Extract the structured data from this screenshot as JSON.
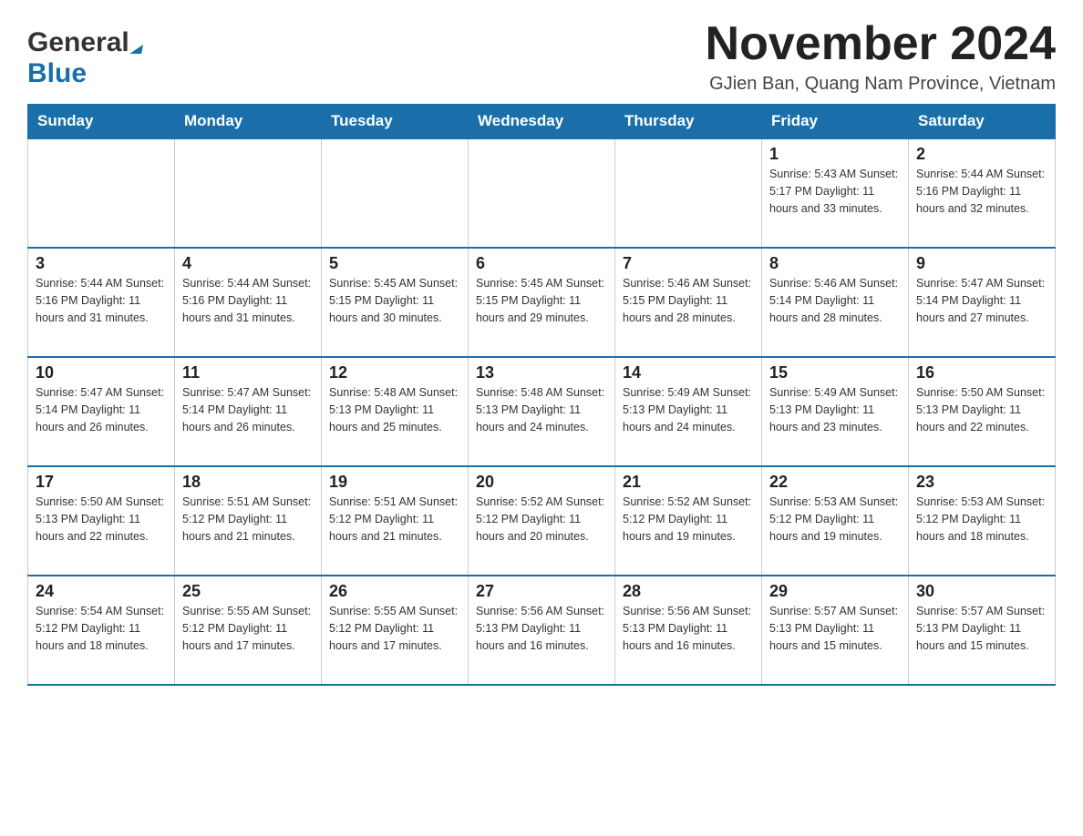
{
  "header": {
    "logo_general": "General",
    "logo_blue": "Blue",
    "month_title": "November 2024",
    "location": "GJien Ban, Quang Nam Province, Vietnam"
  },
  "weekdays": [
    "Sunday",
    "Monday",
    "Tuesday",
    "Wednesday",
    "Thursday",
    "Friday",
    "Saturday"
  ],
  "weeks": [
    [
      {
        "day": "",
        "info": ""
      },
      {
        "day": "",
        "info": ""
      },
      {
        "day": "",
        "info": ""
      },
      {
        "day": "",
        "info": ""
      },
      {
        "day": "",
        "info": ""
      },
      {
        "day": "1",
        "info": "Sunrise: 5:43 AM\nSunset: 5:17 PM\nDaylight: 11 hours and 33 minutes."
      },
      {
        "day": "2",
        "info": "Sunrise: 5:44 AM\nSunset: 5:16 PM\nDaylight: 11 hours and 32 minutes."
      }
    ],
    [
      {
        "day": "3",
        "info": "Sunrise: 5:44 AM\nSunset: 5:16 PM\nDaylight: 11 hours and 31 minutes."
      },
      {
        "day": "4",
        "info": "Sunrise: 5:44 AM\nSunset: 5:16 PM\nDaylight: 11 hours and 31 minutes."
      },
      {
        "day": "5",
        "info": "Sunrise: 5:45 AM\nSunset: 5:15 PM\nDaylight: 11 hours and 30 minutes."
      },
      {
        "day": "6",
        "info": "Sunrise: 5:45 AM\nSunset: 5:15 PM\nDaylight: 11 hours and 29 minutes."
      },
      {
        "day": "7",
        "info": "Sunrise: 5:46 AM\nSunset: 5:15 PM\nDaylight: 11 hours and 28 minutes."
      },
      {
        "day": "8",
        "info": "Sunrise: 5:46 AM\nSunset: 5:14 PM\nDaylight: 11 hours and 28 minutes."
      },
      {
        "day": "9",
        "info": "Sunrise: 5:47 AM\nSunset: 5:14 PM\nDaylight: 11 hours and 27 minutes."
      }
    ],
    [
      {
        "day": "10",
        "info": "Sunrise: 5:47 AM\nSunset: 5:14 PM\nDaylight: 11 hours and 26 minutes."
      },
      {
        "day": "11",
        "info": "Sunrise: 5:47 AM\nSunset: 5:14 PM\nDaylight: 11 hours and 26 minutes."
      },
      {
        "day": "12",
        "info": "Sunrise: 5:48 AM\nSunset: 5:13 PM\nDaylight: 11 hours and 25 minutes."
      },
      {
        "day": "13",
        "info": "Sunrise: 5:48 AM\nSunset: 5:13 PM\nDaylight: 11 hours and 24 minutes."
      },
      {
        "day": "14",
        "info": "Sunrise: 5:49 AM\nSunset: 5:13 PM\nDaylight: 11 hours and 24 minutes."
      },
      {
        "day": "15",
        "info": "Sunrise: 5:49 AM\nSunset: 5:13 PM\nDaylight: 11 hours and 23 minutes."
      },
      {
        "day": "16",
        "info": "Sunrise: 5:50 AM\nSunset: 5:13 PM\nDaylight: 11 hours and 22 minutes."
      }
    ],
    [
      {
        "day": "17",
        "info": "Sunrise: 5:50 AM\nSunset: 5:13 PM\nDaylight: 11 hours and 22 minutes."
      },
      {
        "day": "18",
        "info": "Sunrise: 5:51 AM\nSunset: 5:12 PM\nDaylight: 11 hours and 21 minutes."
      },
      {
        "day": "19",
        "info": "Sunrise: 5:51 AM\nSunset: 5:12 PM\nDaylight: 11 hours and 21 minutes."
      },
      {
        "day": "20",
        "info": "Sunrise: 5:52 AM\nSunset: 5:12 PM\nDaylight: 11 hours and 20 minutes."
      },
      {
        "day": "21",
        "info": "Sunrise: 5:52 AM\nSunset: 5:12 PM\nDaylight: 11 hours and 19 minutes."
      },
      {
        "day": "22",
        "info": "Sunrise: 5:53 AM\nSunset: 5:12 PM\nDaylight: 11 hours and 19 minutes."
      },
      {
        "day": "23",
        "info": "Sunrise: 5:53 AM\nSunset: 5:12 PM\nDaylight: 11 hours and 18 minutes."
      }
    ],
    [
      {
        "day": "24",
        "info": "Sunrise: 5:54 AM\nSunset: 5:12 PM\nDaylight: 11 hours and 18 minutes."
      },
      {
        "day": "25",
        "info": "Sunrise: 5:55 AM\nSunset: 5:12 PM\nDaylight: 11 hours and 17 minutes."
      },
      {
        "day": "26",
        "info": "Sunrise: 5:55 AM\nSunset: 5:12 PM\nDaylight: 11 hours and 17 minutes."
      },
      {
        "day": "27",
        "info": "Sunrise: 5:56 AM\nSunset: 5:13 PM\nDaylight: 11 hours and 16 minutes."
      },
      {
        "day": "28",
        "info": "Sunrise: 5:56 AM\nSunset: 5:13 PM\nDaylight: 11 hours and 16 minutes."
      },
      {
        "day": "29",
        "info": "Sunrise: 5:57 AM\nSunset: 5:13 PM\nDaylight: 11 hours and 15 minutes."
      },
      {
        "day": "30",
        "info": "Sunrise: 5:57 AM\nSunset: 5:13 PM\nDaylight: 11 hours and 15 minutes."
      }
    ]
  ]
}
